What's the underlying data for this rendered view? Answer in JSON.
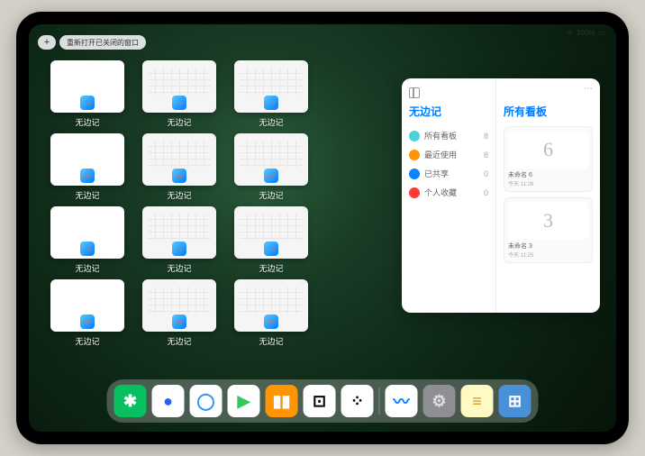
{
  "status": {
    "signal": "᠁",
    "battery": "100%"
  },
  "top": {
    "plus": "+",
    "reopen_label": "重新打开已关闭的窗口"
  },
  "app_name": "无边记",
  "tiles": [
    {
      "type": "blank"
    },
    {
      "type": "calendar"
    },
    {
      "type": "calendar"
    },
    null,
    {
      "type": "blank"
    },
    {
      "type": "calendar"
    },
    {
      "type": "calendar"
    },
    null,
    {
      "type": "blank"
    },
    {
      "type": "calendar"
    },
    {
      "type": "calendar"
    },
    null,
    {
      "type": "blank"
    },
    {
      "type": "calendar"
    },
    {
      "type": "calendar"
    },
    null
  ],
  "sidebar": {
    "title": "无边记",
    "items": [
      {
        "icon_color": "#4cd3d9",
        "label": "所有看板",
        "count": 8
      },
      {
        "icon_color": "#ff9500",
        "label": "最近使用",
        "count": 8
      },
      {
        "icon_color": "#0a84ff",
        "label": "已共享",
        "count": 0
      },
      {
        "icon_color": "#ff3b30",
        "label": "个人收藏",
        "count": 0
      }
    ],
    "right_title": "所有看板",
    "boards": [
      {
        "glyph": "6",
        "label": "未命名 6",
        "sub": "今天 11:26"
      },
      {
        "glyph": "3",
        "label": "未命名 3",
        "sub": "今天 11:25"
      }
    ]
  },
  "dock": [
    {
      "name": "wechat",
      "bg": "#07c160",
      "glyph": "✱"
    },
    {
      "name": "quark",
      "bg": "#ffffff",
      "glyph": "●",
      "fg": "#2b5cff"
    },
    {
      "name": "qqbrowser",
      "bg": "#ffffff",
      "glyph": "◯",
      "fg": "#1e90ff"
    },
    {
      "name": "play",
      "bg": "#ffffff",
      "glyph": "▶",
      "fg": "#34c759"
    },
    {
      "name": "books",
      "bg": "#ff9500",
      "glyph": "▮▮",
      "fg": "#fff"
    },
    {
      "name": "dice",
      "bg": "#ffffff",
      "glyph": "⊡",
      "fg": "#000"
    },
    {
      "name": "grid",
      "bg": "#ffffff",
      "glyph": "⁘",
      "fg": "#000"
    },
    {
      "bg": "sep"
    },
    {
      "name": "freeform",
      "bg": "#ffffff",
      "glyph": "〰",
      "fg": "#007aff"
    },
    {
      "name": "settings",
      "bg": "#8e8e93",
      "glyph": "⚙",
      "fg": "#ddd"
    },
    {
      "name": "notes",
      "bg": "#fff9c4",
      "glyph": "≡",
      "fg": "#d4a017"
    },
    {
      "name": "app-library",
      "bg": "#4a90d9",
      "glyph": "⊞",
      "fg": "#fff"
    }
  ]
}
